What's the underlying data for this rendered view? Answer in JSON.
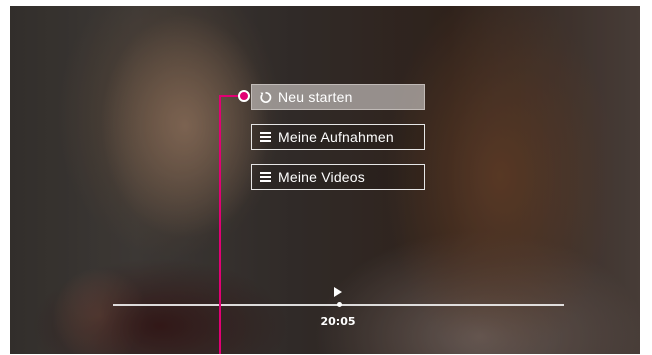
{
  "menu": {
    "items": [
      {
        "label": "Neu starten",
        "icon": "restart-icon",
        "focused": true
      },
      {
        "label": "Meine Aufnahmen",
        "icon": "menu-icon",
        "focused": false
      },
      {
        "label": "Meine Videos",
        "icon": "menu-icon",
        "focused": false
      }
    ]
  },
  "player": {
    "time": "20:05",
    "progress": 0.5,
    "state_icon": "play-icon"
  },
  "colors": {
    "callout": "#e20074",
    "menu_text": "#ffffff",
    "focused_bg": "#bcb7b4"
  }
}
